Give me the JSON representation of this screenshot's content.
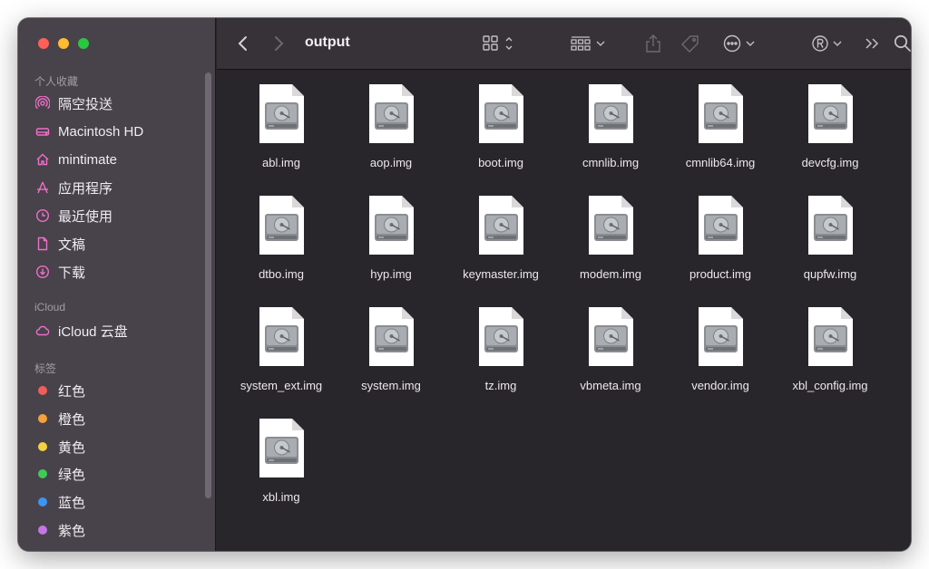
{
  "window": {
    "title": "output"
  },
  "sidebar": {
    "favorites_title": "个人收藏",
    "favorites": [
      {
        "label": "隔空投送",
        "icon": "airdrop-icon"
      },
      {
        "label": "Macintosh HD",
        "icon": "disk-icon"
      },
      {
        "label": "mintimate",
        "icon": "home-icon"
      },
      {
        "label": "应用程序",
        "icon": "applications-icon"
      },
      {
        "label": "最近使用",
        "icon": "clock-icon"
      },
      {
        "label": "文稿",
        "icon": "document-icon"
      },
      {
        "label": "下载",
        "icon": "download-icon"
      }
    ],
    "icloud_title": "iCloud",
    "icloud": [
      {
        "label": "iCloud 云盘",
        "icon": "cloud-icon"
      }
    ],
    "tags_title": "标签",
    "tags": [
      {
        "label": "红色",
        "color": "#ef5f5a"
      },
      {
        "label": "橙色",
        "color": "#f5a23b"
      },
      {
        "label": "黄色",
        "color": "#f2d33d"
      },
      {
        "label": "绿色",
        "color": "#3fcc55"
      },
      {
        "label": "蓝色",
        "color": "#3d95f0"
      },
      {
        "label": "紫色",
        "color": "#c575e3"
      }
    ]
  },
  "toolbar": {
    "back": "chevron-left-icon",
    "forward": "chevron-right-icon",
    "view": "grid-view-icon",
    "group": "group-icon",
    "share": "share-icon",
    "tags": "tag-icon",
    "action": "ellipsis-icon",
    "extension": "registered-icon",
    "more": "double-chevron-icon",
    "search": "search-icon"
  },
  "files": [
    "abl.img",
    "aop.img",
    "boot.img",
    "cmnlib.img",
    "cmnlib64.img",
    "devcfg.img",
    "dtbo.img",
    "hyp.img",
    "keymaster.img",
    "modem.img",
    "product.img",
    "qupfw.img",
    "system_ext.img",
    "system.img",
    "tz.img",
    "vbmeta.img",
    "vendor.img",
    "xbl_config.img",
    "xbl.img"
  ]
}
